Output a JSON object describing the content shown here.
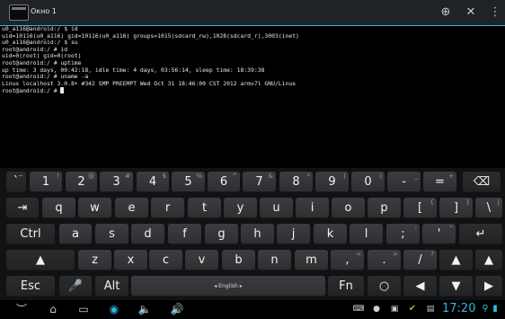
{
  "titlebar": {
    "tab_title": "Окно 1",
    "new_window_icon": "⊕",
    "close_icon": "✕",
    "menu_icon": "⋮"
  },
  "terminal": {
    "lines": [
      "u0_a116@android:/ $ id",
      "uid=10116(u0_a116) gid=10116(u0_a116) groups=1015(sdcard_rw),1028(sdcard_r),3003(inet)",
      "u0_a116@android:/ $ su",
      "root@android:/ # id",
      "uid=0(root) gid=0(root)",
      "root@android:/ # uptime",
      "up time: 3 days, 00:42:18, idle time: 4 days, 03:56:14, sleep time: 18:39:38",
      "root@android:/ # uname -a",
      "Linux localhost 3.0.8+ #342 SMP PREEMPT Wed Oct 31 18:46:00 CST 2012 armv7l GNU/Linux",
      "root@android:/ # "
    ]
  },
  "keyboard": {
    "row1": [
      {
        "main": "`",
        "hint": "~"
      },
      {
        "main": "1",
        "hint": "!"
      },
      {
        "main": "2",
        "hint": "@"
      },
      {
        "main": "3",
        "hint": "#"
      },
      {
        "main": "4",
        "hint": "$"
      },
      {
        "main": "5",
        "hint": "%"
      },
      {
        "main": "6",
        "hint": "^"
      },
      {
        "main": "7",
        "hint": "&"
      },
      {
        "main": "8",
        "hint": "*"
      },
      {
        "main": "9",
        "hint": "("
      },
      {
        "main": "0",
        "hint": ")"
      },
      {
        "main": "-",
        "hint": "_"
      },
      {
        "main": "=",
        "hint": "+"
      },
      {
        "main": "⌫",
        "hint": ""
      }
    ],
    "row2": [
      {
        "main": "⇥",
        "hint": ""
      },
      {
        "main": "q",
        "hint": ""
      },
      {
        "main": "w",
        "hint": ""
      },
      {
        "main": "e",
        "hint": ""
      },
      {
        "main": "r",
        "hint": ""
      },
      {
        "main": "t",
        "hint": ""
      },
      {
        "main": "y",
        "hint": ""
      },
      {
        "main": "u",
        "hint": ""
      },
      {
        "main": "i",
        "hint": ""
      },
      {
        "main": "o",
        "hint": ""
      },
      {
        "main": "p",
        "hint": ""
      },
      {
        "main": "[",
        "hint": "{"
      },
      {
        "main": "]",
        "hint": "}"
      },
      {
        "main": "\\",
        "hint": "|"
      }
    ],
    "row3": [
      {
        "main": "Ctrl",
        "hint": ""
      },
      {
        "main": "a",
        "hint": ""
      },
      {
        "main": "s",
        "hint": ""
      },
      {
        "main": "d",
        "hint": ""
      },
      {
        "main": "f",
        "hint": ""
      },
      {
        "main": "g",
        "hint": ""
      },
      {
        "main": "h",
        "hint": ""
      },
      {
        "main": "j",
        "hint": ""
      },
      {
        "main": "k",
        "hint": ""
      },
      {
        "main": "l",
        "hint": ""
      },
      {
        "main": ";",
        "hint": ":"
      },
      {
        "main": "'",
        "hint": "\""
      },
      {
        "main": "↵",
        "hint": ""
      }
    ],
    "row4": [
      {
        "main": "▲",
        "hint": ""
      },
      {
        "main": "z",
        "hint": ""
      },
      {
        "main": "x",
        "hint": ""
      },
      {
        "main": "c",
        "hint": ""
      },
      {
        "main": "v",
        "hint": ""
      },
      {
        "main": "b",
        "hint": ""
      },
      {
        "main": "n",
        "hint": ""
      },
      {
        "main": "m",
        "hint": ""
      },
      {
        "main": ",",
        "hint": "<"
      },
      {
        "main": ".",
        "hint": ">"
      },
      {
        "main": "/",
        "hint": "?"
      },
      {
        "main": "▲",
        "hint": ""
      },
      {
        "main": "▲",
        "hint": ""
      }
    ],
    "row5": [
      {
        "main": "Esc",
        "hint": ""
      },
      {
        "main": "🎤",
        "hint": ""
      },
      {
        "main": "Alt",
        "hint": ""
      },
      {
        "main": "◂ English ▸",
        "hint": ""
      },
      {
        "main": "Fn",
        "hint": ""
      },
      {
        "main": "○",
        "hint": ""
      },
      {
        "main": "◀",
        "hint": ""
      },
      {
        "main": "▼",
        "hint": ""
      },
      {
        "main": "▶",
        "hint": ""
      }
    ]
  },
  "navbar": {
    "back_icon": "︶",
    "home_icon": "⌂",
    "recents_icon": "▭",
    "camera_icon": "◉",
    "volume_down_icon": "🔈",
    "volume_up_icon": "🔊",
    "time": "17:20",
    "accent": "#33b5e5"
  }
}
